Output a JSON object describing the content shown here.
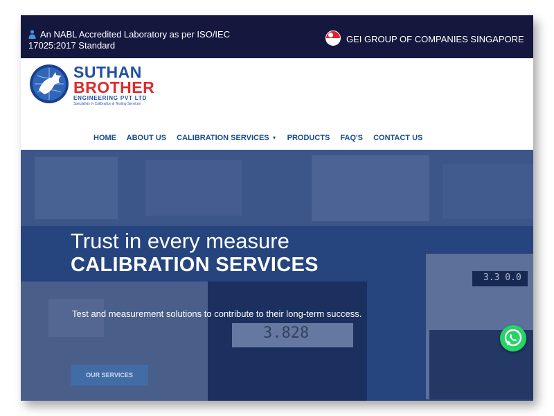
{
  "topbar": {
    "accreditation": "An NABL Accredited Laboratory as per ISO/IEC 17025:2017 Standard",
    "group": "GEI GROUP OF COMPANIES SINGAPORE"
  },
  "logo": {
    "line1": "SUTHAN",
    "line2": "BROTHER",
    "line3": "ENGINEERING PVT LTD",
    "tagline": "Specialists in Calibration & Testing Services"
  },
  "nav": {
    "items": [
      "HOME",
      "ABOUT US",
      "CALIBRATION SERVICES",
      "PRODUCTS",
      "FAQ'S",
      "CONTACT US"
    ]
  },
  "hero": {
    "subtitle": "Trust in every measure",
    "title": "CALIBRATION SERVICES",
    "text": "Test and measurement solutions to contribute to their long-term success.",
    "button": "OUR SERVICES",
    "meter_left": "3.828",
    "meter_right": "3.3 0.0"
  },
  "colors": {
    "topbar": "#14183f",
    "nav": "#174b8c",
    "brand_blue": "#1f4fa3",
    "brand_red": "#e02b2b",
    "whatsapp": "#25d366"
  },
  "icons": [
    "person-icon",
    "singapore-flag-icon",
    "logo-globe-icon",
    "whatsapp-icon"
  ]
}
